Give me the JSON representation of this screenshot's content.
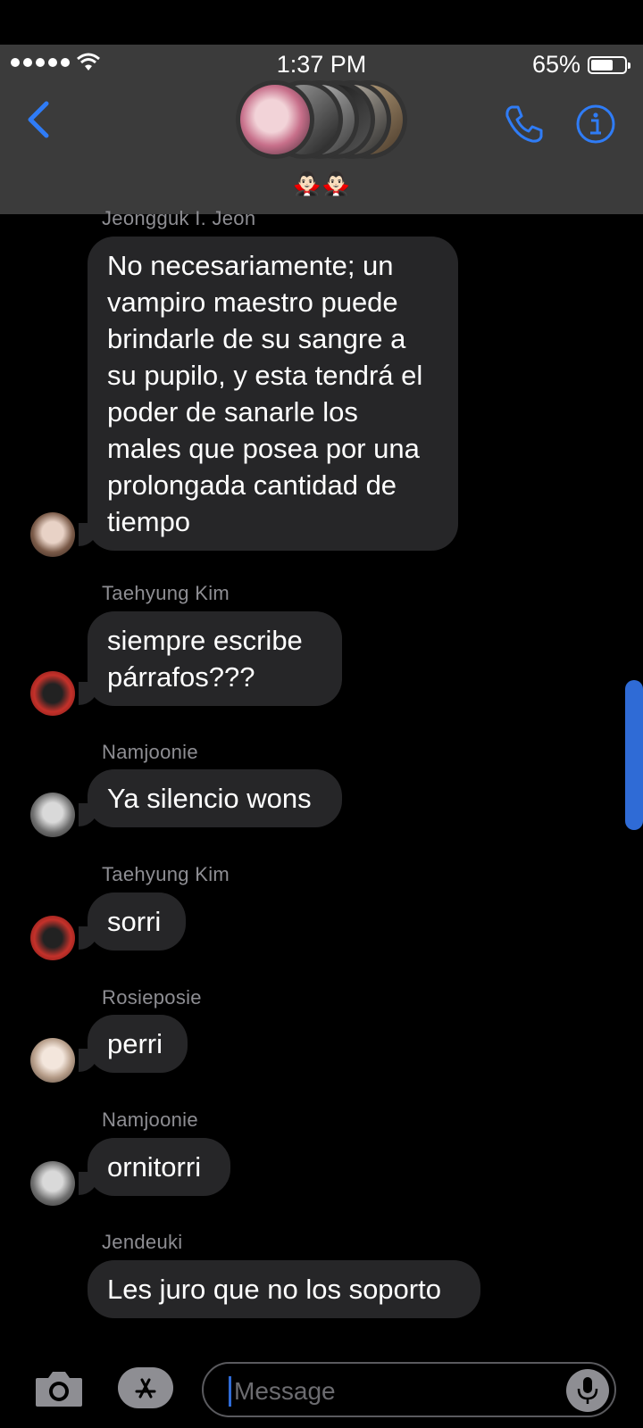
{
  "status_bar": {
    "time": "1:37 PM",
    "battery_percent": "65%",
    "battery_level": 0.65,
    "signal_bars": 5
  },
  "header": {
    "group_emoji": "🧛🏻‍♂️🧛🏻‍♂️",
    "icons": [
      "back-chevron-icon",
      "phone-icon",
      "info-icon"
    ],
    "accent_color": "#2f7cf6",
    "background_color": "#3b3b3b"
  },
  "messages": [
    {
      "sender": "Jeongguk I. Jeon",
      "text": "No necesariamente; un vampiro maestro puede brindarle de su sangre a su pupilo, y esta tendrá el poder de sanarle los males que posea por una prolongada cantidad de tiempo"
    },
    {
      "sender": "Taehyung Kim",
      "text": "siempre escribe párrafos???"
    },
    {
      "sender": "Namjoonie",
      "text": "Ya silencio wons"
    },
    {
      "sender": "Taehyung Kim",
      "text": "sorri"
    },
    {
      "sender": "Rosieposie",
      "text": "perri"
    },
    {
      "sender": "Namjoonie",
      "text": "ornitorri"
    },
    {
      "sender": "Jendeuki",
      "text": "Les juro que no los soporto"
    }
  ],
  "bubble_color": "#262628",
  "composer": {
    "placeholder": "Message",
    "icons": [
      "camera-icon",
      "app-store-icon",
      "microphone-icon"
    ]
  }
}
